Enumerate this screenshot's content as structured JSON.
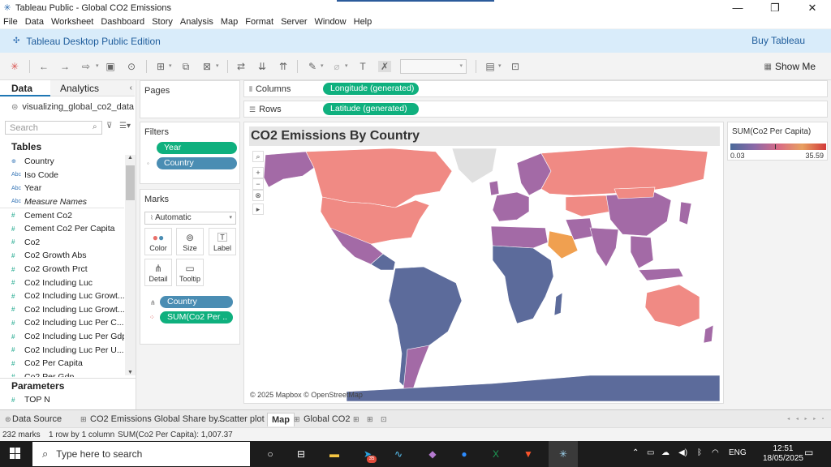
{
  "window": {
    "title": "Tableau Public - Global CO2 Emissions",
    "minimize": "—",
    "maximize": "❐",
    "close": "✕"
  },
  "menu": [
    "File",
    "Data",
    "Worksheet",
    "Dashboard",
    "Story",
    "Analysis",
    "Map",
    "Format",
    "Server",
    "Window",
    "Help"
  ],
  "banner": {
    "edition": "Tableau Desktop Public Edition",
    "buy": "Buy Tableau"
  },
  "toolbar": {
    "show_me": "Show Me"
  },
  "data_pane": {
    "tab_data": "Data",
    "tab_analytics": "Analytics",
    "datasource": "visualizing_global_co2_data",
    "search_placeholder": "Search",
    "tables_heading": "Tables",
    "fields": [
      {
        "name": "Country",
        "type": "geo"
      },
      {
        "name": "Iso Code",
        "type": "abc"
      },
      {
        "name": "Year",
        "type": "abc"
      },
      {
        "name": "Measure Names",
        "type": "abc"
      },
      {
        "name": "Cement Co2",
        "type": "measure"
      },
      {
        "name": "Cement Co2 Per Capita",
        "type": "measure"
      },
      {
        "name": "Co2",
        "type": "measure"
      },
      {
        "name": "Co2 Growth Abs",
        "type": "measure"
      },
      {
        "name": "Co2 Growth Prct",
        "type": "measure"
      },
      {
        "name": "Co2 Including Luc",
        "type": "measure"
      },
      {
        "name": "Co2 Including Luc Growt...",
        "type": "measure"
      },
      {
        "name": "Co2 Including Luc Growt...",
        "type": "measure"
      },
      {
        "name": "Co2 Including Luc Per C...",
        "type": "measure"
      },
      {
        "name": "Co2 Including Luc Per Gdp",
        "type": "measure"
      },
      {
        "name": "Co2 Including Luc Per U...",
        "type": "measure"
      },
      {
        "name": "Co2 Per Capita",
        "type": "measure"
      },
      {
        "name": "Co2 Per Gdp",
        "type": "measure"
      }
    ],
    "parameters_heading": "Parameters",
    "parameters": [
      "TOP N"
    ]
  },
  "pages": {
    "title": "Pages"
  },
  "filters": {
    "title": "Filters",
    "pills": [
      "Year",
      "Country"
    ]
  },
  "marks": {
    "title": "Marks",
    "type": "Automatic",
    "buttons": [
      "Color",
      "Size",
      "Label",
      "Detail",
      "Tooltip"
    ],
    "pills": [
      "Country",
      "SUM(Co2 Per .."
    ]
  },
  "shelves": {
    "columns_label": "Columns",
    "columns_pill": "Longitude (generated)",
    "rows_label": "Rows",
    "rows_pill": "Latitude (generated)"
  },
  "view": {
    "title": "CO2 Emissions By Country",
    "attribution": "© 2025 Mapbox © OpenStreetMap"
  },
  "legend": {
    "title": "SUM(Co2 Per Capita)",
    "min": "0.03",
    "max": "35.59",
    "colors": [
      "#4a6a9a",
      "#8b6aa8",
      "#d86a86",
      "#e8a060",
      "#d23a3a"
    ]
  },
  "sheet_tabs": {
    "data_source": "Data Source",
    "tabs": [
      "CO2 Emissions Global Share by...",
      "Scatter plot",
      "Map",
      "Global CO2"
    ],
    "active": "Map"
  },
  "status": {
    "marks": "232 marks",
    "dims": "1 row by 1 column",
    "sum": "SUM(Co2 Per Capita): 1,007.37"
  },
  "taskbar": {
    "search_placeholder": "Type here to search",
    "lang": "ENG",
    "time": "12:51",
    "date": "18/05/2025",
    "telegram_badge": "35"
  },
  "map_colors": {
    "ocean": "#ffffff",
    "high": "#f08a84",
    "mid": "#a36aa6",
    "low": "#5c6b9b",
    "highest": "#f0a050",
    "gray": "#e0e0e0"
  }
}
